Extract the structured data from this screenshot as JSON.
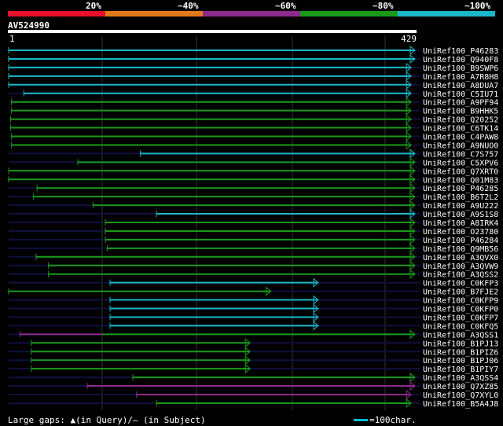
{
  "legend": {
    "labels": [
      "20%",
      "~40%",
      "~60%",
      "~80%",
      "~100%"
    ],
    "colors": [
      "#e8102a",
      "#e07b17",
      "#8e2a8e",
      "#1a9a1a",
      "#1ab8c8"
    ]
  },
  "query": {
    "name": "AV524990",
    "start": "1",
    "end": "429"
  },
  "hits": [
    {
      "name": "UniRef100_P46283",
      "color": "#1ab8c8",
      "start": 1,
      "end": 429,
      "arrow": true
    },
    {
      "name": "UniRef100_Q940F8",
      "color": "#1ab8c8",
      "start": 1,
      "end": 429,
      "arrow": true
    },
    {
      "name": "UniRef100_B9SWP6",
      "color": "#1ab8c8",
      "start": 1,
      "end": 425,
      "arrow": true
    },
    {
      "name": "UniRef100_A7R8H8",
      "color": "#1ab8c8",
      "start": 1,
      "end": 425,
      "arrow": true
    },
    {
      "name": "UniRef100_A8DUA7",
      "color": "#1ab8c8",
      "start": 1,
      "end": 425,
      "arrow": true
    },
    {
      "name": "UniRef100_C5IU71",
      "color": "#1ab8c8",
      "start": 17,
      "end": 425,
      "arrow": true
    },
    {
      "name": "UniRef100_A9PF94",
      "color": "#1a9a1a",
      "start": 4,
      "end": 425,
      "arrow": true
    },
    {
      "name": "UniRef100_B9HHK5",
      "color": "#1a9a1a",
      "start": 4,
      "end": 425,
      "arrow": true
    },
    {
      "name": "UniRef100_Q20252",
      "color": "#1a9a1a",
      "start": 3,
      "end": 425,
      "arrow": true
    },
    {
      "name": "UniRef100_C6TK14",
      "color": "#1a9a1a",
      "start": 3,
      "end": 425,
      "arrow": true
    },
    {
      "name": "UniRef100_C4PAW8",
      "color": "#1a9a1a",
      "start": 4,
      "end": 425,
      "arrow": true
    },
    {
      "name": "UniRef100_A9NUO0",
      "color": "#1a9a1a",
      "start": 4,
      "end": 425,
      "arrow": true
    },
    {
      "name": "UniRef100_C7S757",
      "color": "#1ab8c8",
      "start": 140,
      "end": 429,
      "arrow": true
    },
    {
      "name": "UniRef100_C5XPV6",
      "color": "#1a9a1a",
      "start": 74,
      "end": 429,
      "arrow": true
    },
    {
      "name": "UniRef100_Q7XRT0",
      "color": "#1a9a1a",
      "start": 1,
      "end": 429,
      "arrow": true
    },
    {
      "name": "UniRef100_Q01M83",
      "color": "#1a9a1a",
      "start": 1,
      "end": 429,
      "arrow": true
    },
    {
      "name": "UniRef100_P46285",
      "color": "#1a9a1a",
      "start": 31,
      "end": 429,
      "arrow": true
    },
    {
      "name": "UniRef100_B6T2L2",
      "color": "#1a9a1a",
      "start": 27,
      "end": 429,
      "arrow": true
    },
    {
      "name": "UniRef100_A9U222",
      "color": "#1a9a1a",
      "start": 90,
      "end": 429,
      "arrow": true
    },
    {
      "name": "UniRef100_A9S1S8",
      "color": "#1ab8c8",
      "start": 157,
      "end": 429,
      "arrow": true
    },
    {
      "name": "UniRef100_A8IRK4",
      "color": "#1a9a1a",
      "start": 103,
      "end": 429,
      "arrow": true
    },
    {
      "name": "UniRef100_O23780",
      "color": "#1a9a1a",
      "start": 103,
      "end": 429,
      "arrow": true
    },
    {
      "name": "UniRef100_P46284",
      "color": "#1a9a1a",
      "start": 103,
      "end": 429,
      "arrow": true
    },
    {
      "name": "UniRef100_Q9MB56",
      "color": "#1a9a1a",
      "start": 105,
      "end": 429,
      "arrow": true
    },
    {
      "name": "UniRef100_A3QVX0",
      "color": "#1a9a1a",
      "start": 30,
      "end": 429,
      "arrow": true
    },
    {
      "name": "UniRef100_A3QVW9",
      "color": "#1a9a1a",
      "start": 43,
      "end": 429,
      "arrow": true
    },
    {
      "name": "UniRef100_A3QSS2",
      "color": "#1a9a1a",
      "start": 43,
      "end": 429,
      "arrow": true
    },
    {
      "name": "UniRef100_C0KFP3",
      "color": "#1ab8c8",
      "start": 108,
      "end": 327,
      "arrow": true
    },
    {
      "name": "UniRef100_B7FJE2",
      "color": "#1a9a1a",
      "start": 1,
      "end": 277,
      "arrow": true
    },
    {
      "name": "UniRef100_C0KFP9",
      "color": "#1ab8c8",
      "start": 108,
      "end": 327,
      "arrow": true
    },
    {
      "name": "UniRef100_C0KFP0",
      "color": "#1ab8c8",
      "start": 108,
      "end": 327,
      "arrow": true
    },
    {
      "name": "UniRef100_C0KFP7",
      "color": "#1ab8c8",
      "start": 108,
      "end": 327,
      "arrow": true
    },
    {
      "name": "UniRef100_C0KFQ5",
      "color": "#1ab8c8",
      "start": 108,
      "end": 327,
      "arrow": true
    },
    {
      "name": "UniRef100_A3QSS1",
      "color": "#8e2a8e",
      "start": 13,
      "end": 100,
      "color2": "#1a9a1a",
      "end2": 429,
      "arrow": true
    },
    {
      "name": "UniRef100_B1PJ13",
      "color": "#1a9a1a",
      "start": 25,
      "end": 255,
      "arrow": true
    },
    {
      "name": "UniRef100_B1PIZ6",
      "color": "#1a9a1a",
      "start": 25,
      "end": 255,
      "arrow": true
    },
    {
      "name": "UniRef100_B1PJ06",
      "color": "#1a9a1a",
      "start": 25,
      "end": 255,
      "arrow": true
    },
    {
      "name": "UniRef100_B1PIY7",
      "color": "#1a9a1a",
      "start": 25,
      "end": 255,
      "arrow": true
    },
    {
      "name": "UniRef100_A3QSS4",
      "color": "#1a9a1a",
      "start": 132,
      "end": 429,
      "arrow": true
    },
    {
      "name": "UniRef100_Q7XZ85",
      "color": "#8e2a8e",
      "start": 84,
      "end": 429,
      "arrow": true
    },
    {
      "name": "UniRef100_Q7XYL0",
      "color": "#8e2a8e",
      "start": 136,
      "end": 425,
      "arrow": true
    },
    {
      "name": "UniRef100_B5A4J8",
      "color": "#1a9a1a",
      "start": 157,
      "end": 425,
      "arrow": true
    }
  ],
  "footer": {
    "gaps_label": "Large gaps: ▲(in Query)/– (in Subject)",
    "scale_label": "=100char."
  }
}
